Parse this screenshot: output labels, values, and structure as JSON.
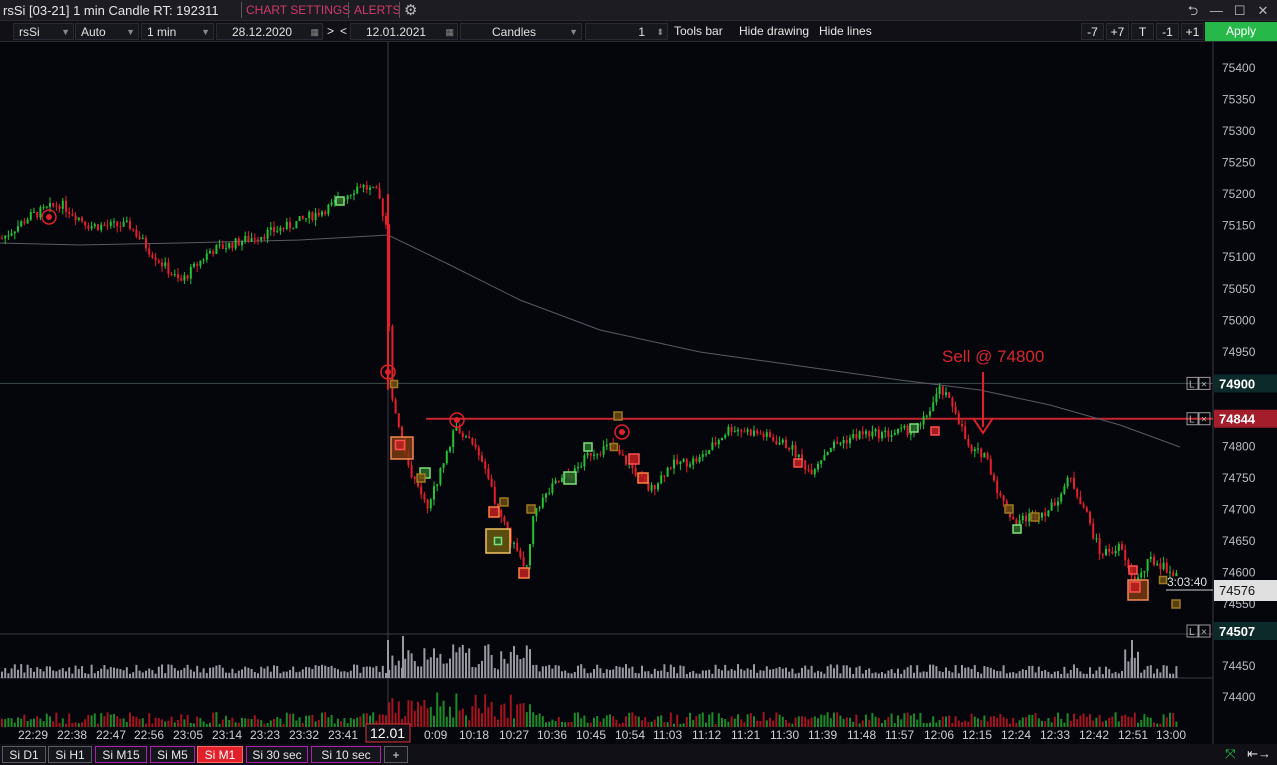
{
  "window": {
    "title": "rsSi [03-21] 1 min Candle RT: 192311",
    "chart_settings": "CHART SETTINGS",
    "alerts": "ALERTS",
    "pin": "⮌",
    "minimize": "—",
    "maximize": "☐",
    "close": "✕"
  },
  "toolbar": {
    "symbol": "rsSi",
    "scale": "Auto",
    "timeframe": "1 min",
    "date_from": "28.12.2020",
    "nav_next": ">",
    "nav_prev": "<",
    "date_to": "12.01.2021",
    "chart_type": "Candles",
    "count": "1",
    "tools_bar": "Tools bar",
    "hide_drawing": "Hide drawing",
    "hide_lines": "Hide lines",
    "minus7": "-7",
    "plus7": "+7",
    "t": "T",
    "minus1": "-1",
    "plus1": "+1",
    "apply": "Apply"
  },
  "chart_data": {
    "type": "candlestick",
    "symbol": "rsSi",
    "price_ticks": [
      75400,
      75350,
      75300,
      75250,
      75200,
      75150,
      75100,
      75050,
      75000,
      74950,
      74900,
      74850,
      74800,
      74750,
      74700,
      74650,
      74600,
      74550,
      74450,
      74400
    ],
    "price_labels": {
      "level_1": "74900",
      "level_2": "74844",
      "last_price": "74576",
      "volume_top": "74507"
    },
    "countdown": "3:03:40",
    "annotation": "Sell @ 74800",
    "horizontal_lines": [
      74900,
      74844
    ],
    "time_labels": [
      "22:29",
      "22:38",
      "22:47",
      "22:56",
      "23:05",
      "23:14",
      "23:23",
      "23:32",
      "23:41",
      "12.01",
      "0:09",
      "10:18",
      "10:27",
      "10:36",
      "10:45",
      "10:54",
      "11:03",
      "11:12",
      "11:21",
      "11:30",
      "11:39",
      "11:48",
      "11:57",
      "12:06",
      "12:15",
      "12:24",
      "12:33",
      "12:42",
      "12:51",
      "13:00"
    ],
    "line_label_tag": "L",
    "colors": {
      "up": "#26c234",
      "down": "#e5202c",
      "lines": "#c8252f",
      "volume": "#9a9aa2"
    }
  },
  "bottom_tabs": [
    "Si D1",
    "Si H1",
    "Si M15",
    "Si M5",
    "Si M1",
    "Si 30 sec",
    "Si  10  sec",
    "+"
  ],
  "bottom_icons": {
    "fit": "⤧",
    "arrows": "⇤→"
  }
}
